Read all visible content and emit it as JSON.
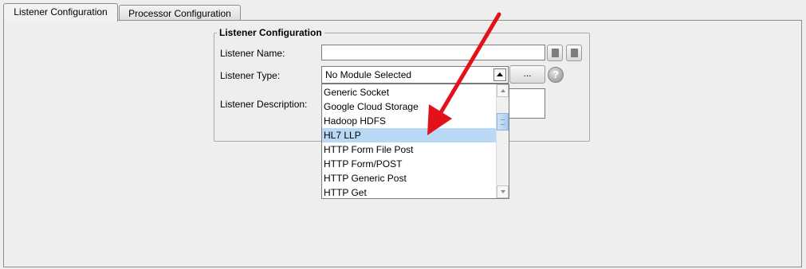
{
  "tabs": [
    {
      "label": "Listener Configuration",
      "active": true
    },
    {
      "label": "Processor Configuration",
      "active": false
    }
  ],
  "group": {
    "title": "Listener Configuration",
    "name_label": "Listener Name:",
    "name_value": "",
    "type_label": "Listener Type:",
    "type_value": "No Module Selected",
    "browse_label": "...",
    "help_glyph": "?",
    "description_label": "Listener Description:",
    "description_value": ""
  },
  "dropdown": {
    "options": [
      "Generic Socket",
      "Google Cloud Storage",
      "Hadoop HDFS",
      "HL7 LLP",
      "HTTP Form File Post",
      "HTTP Form/POST",
      "HTTP Generic Post",
      "HTTP Get"
    ],
    "highlighted": "HL7 LLP"
  },
  "annotation": {
    "color": "#e3111a"
  },
  "colors": {
    "highlight": "#b8d8f6",
    "panel": "#eeeeee"
  }
}
